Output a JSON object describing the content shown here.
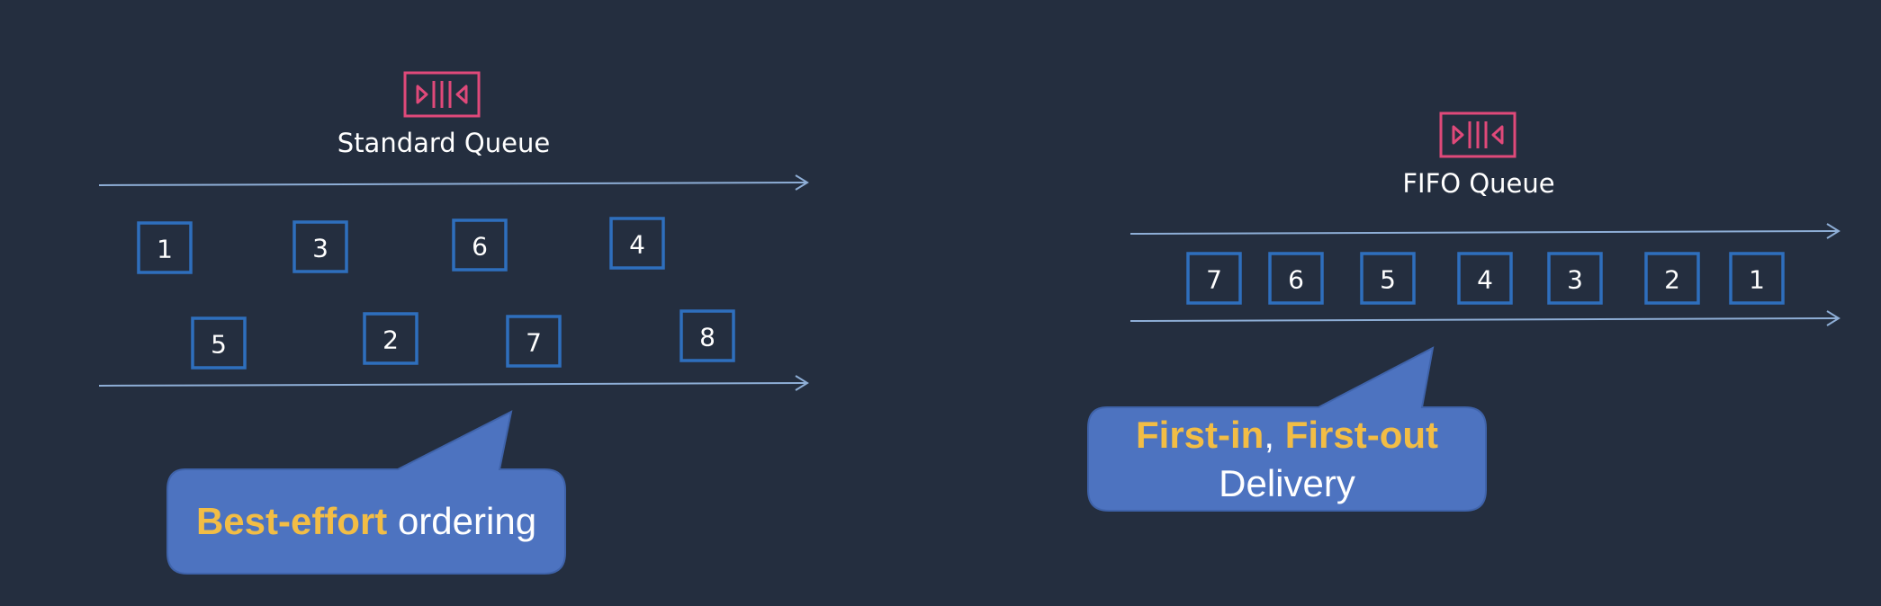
{
  "standard": {
    "title": "Standard Queue",
    "row1": [
      "1",
      "3",
      "6",
      "4"
    ],
    "row2": [
      "5",
      "2",
      "7",
      "8"
    ],
    "callout": {
      "highlight": "Best-effort",
      "rest": " ordering"
    }
  },
  "fifo": {
    "title": "FIFO Queue",
    "messages": [
      "7",
      "6",
      "5",
      "4",
      "3",
      "2",
      "1"
    ],
    "callout": {
      "highlight1": "First-in",
      "separator": ", ",
      "highlight2": "First-out",
      "line2": "Delivery"
    }
  },
  "colors": {
    "background": "#242e3f",
    "queue_icon": "#e0497a",
    "message_box": "#2e6fbd",
    "arrow": "#8eaed6",
    "callout_fill": "#4d73c0",
    "highlight_text": "#f2bd45"
  }
}
